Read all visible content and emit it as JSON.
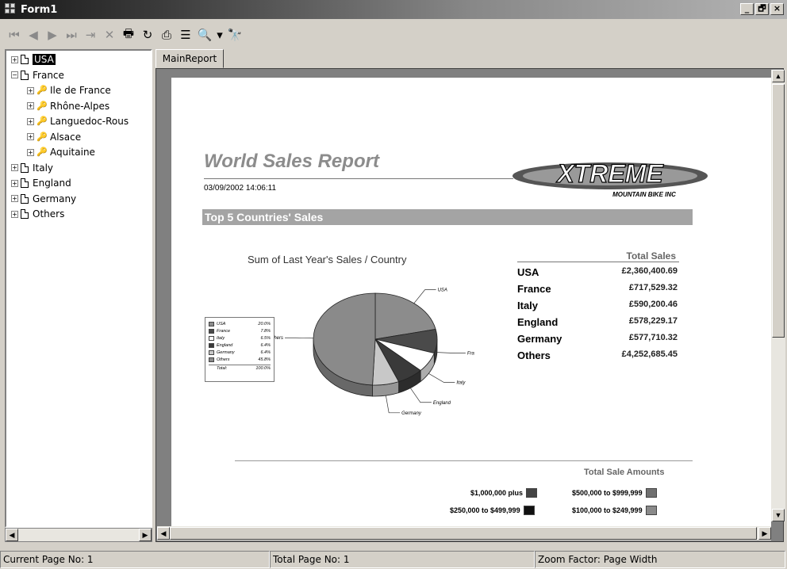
{
  "window": {
    "title": "Form1",
    "minimize": "_",
    "maximize": "🗗",
    "close": "×"
  },
  "toolbar": {
    "icons": [
      "first-page-icon",
      "prev-page-icon",
      "next-page-icon",
      "last-page-icon",
      "goto-page-icon",
      "stop-icon",
      "print-icon",
      "refresh-icon",
      "export-icon",
      "tree-toggle-icon",
      "zoom-icon",
      "dropdown-icon",
      "search-icon"
    ],
    "glyphs": {
      "first": "⏮",
      "prev": "◀",
      "next": "▶",
      "last": "⏭",
      "goto": "⇥",
      "stop": "✕",
      "print": "🖶",
      "refresh": "↻",
      "export": "⎙",
      "tree": "☰",
      "zoom": "🔍",
      "dropdown": "▾",
      "search": "🔭"
    }
  },
  "tree": {
    "items": [
      {
        "label": "USA",
        "level": 0,
        "expander": "+",
        "icon": "document-icon",
        "selected": true
      },
      {
        "label": "France",
        "level": 0,
        "expander": "−",
        "icon": "document-icon"
      },
      {
        "label": "Ile de France",
        "level": 1,
        "expander": "+",
        "icon": "key-icon"
      },
      {
        "label": "Rhône-Alpes",
        "level": 1,
        "expander": "+",
        "icon": "key-icon"
      },
      {
        "label": "Languedoc-Rous",
        "level": 1,
        "expander": "+",
        "icon": "key-icon"
      },
      {
        "label": "Alsace",
        "level": 1,
        "expander": "+",
        "icon": "key-icon"
      },
      {
        "label": "Aquitaine",
        "level": 1,
        "expander": "+",
        "icon": "key-icon"
      },
      {
        "label": "Italy",
        "level": 0,
        "expander": "+",
        "icon": "document-icon"
      },
      {
        "label": "England",
        "level": 0,
        "expander": "+",
        "icon": "document-icon"
      },
      {
        "label": "Germany",
        "level": 0,
        "expander": "+",
        "icon": "document-icon"
      },
      {
        "label": "Others",
        "level": 0,
        "expander": "+",
        "icon": "document-icon"
      }
    ]
  },
  "tab": {
    "label": "MainReport"
  },
  "report": {
    "title": "World Sales Report",
    "date": "03/09/2002  14:06:11",
    "logo_main": "XTREME",
    "logo_sub": "MOUNTAIN BIKE INC",
    "section": "Top 5 Countries' Sales",
    "chart_title": "Sum of Last Year's Sales / Country",
    "sales_header": "Total Sales",
    "sales": [
      {
        "country": "USA",
        "amount": "£2,360,400.69"
      },
      {
        "country": "France",
        "amount": "£717,529.32"
      },
      {
        "country": "Italy",
        "amount": "£590,200.46"
      },
      {
        "country": "England",
        "amount": "£578,229.17"
      },
      {
        "country": "Germany",
        "amount": "£577,710.32"
      },
      {
        "country": "Others",
        "amount": "£4,252,685.45"
      }
    ],
    "amounts_title": "Total Sale Amounts",
    "amount_ranges": [
      {
        "label": "$1,000,000 plus",
        "color": "#444444"
      },
      {
        "label": "$500,000 to $999,999",
        "color": "#707070"
      },
      {
        "label": "$250,000 to $499,999",
        "color": "#111111"
      },
      {
        "label": "$100,000 to $249,999",
        "color": "#8a8a8a"
      }
    ]
  },
  "chart_data": {
    "type": "pie",
    "title": "Sum of Last Year's Sales / Country",
    "categories": [
      "USA",
      "France",
      "Italy",
      "England",
      "Germany",
      "Others"
    ],
    "values": [
      20.0,
      7.8,
      6.5,
      6.4,
      6.4,
      45.8
    ],
    "value_labels": [
      "20.0%",
      "7.8%",
      "6.5%",
      "6.4%",
      "6.4%",
      "45.8%"
    ],
    "colors": [
      "#8c8c8c",
      "#4a4a4a",
      "#ffffff",
      "#3a3a3a",
      "#c8c8c8",
      "#8a8a8a"
    ],
    "legend": {
      "total_label": "Total:",
      "total_value": "100.0%",
      "placement": "left"
    }
  },
  "status": {
    "current_page": "Current Page No: 1",
    "total_page": "Total Page No: 1",
    "zoom": "Zoom Factor: Page Width"
  }
}
